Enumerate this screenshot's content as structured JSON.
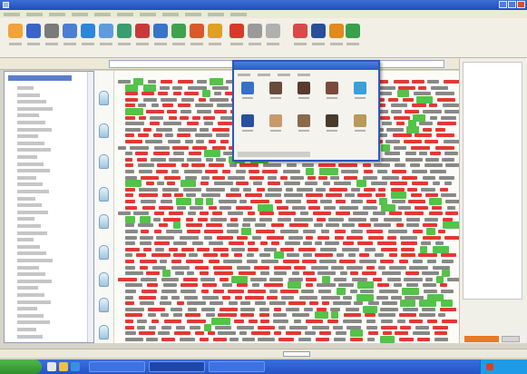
{
  "window": {
    "title": ""
  },
  "menu": {
    "items": [
      "",
      "",
      "",
      "",
      "",
      "",
      "",
      "",
      "",
      "",
      ""
    ]
  },
  "toolbar": {
    "buttons": [
      {
        "label": "",
        "icon": "new-document-icon",
        "color": "#f1a23a"
      },
      {
        "label": "",
        "icon": "save-icon",
        "color": "#3a64c8"
      },
      {
        "label": "",
        "icon": "print-icon",
        "color": "#7a7a7a"
      },
      {
        "label": "",
        "icon": "computer-icon",
        "color": "#4a7fd1"
      },
      {
        "label": "",
        "icon": "search-icon",
        "color": "#2f86d8"
      },
      {
        "label": "",
        "icon": "copy-icon",
        "color": "#5f9bdc"
      },
      {
        "label": "",
        "icon": "table-icon",
        "color": "#3a9d6e"
      },
      {
        "label": "",
        "icon": "font-icon",
        "color": "#c83a3a"
      },
      {
        "label": "",
        "icon": "globe-icon",
        "color": "#3a74c8"
      },
      {
        "label": "",
        "icon": "arrow-icon",
        "color": "#3fa34d"
      },
      {
        "label": "",
        "icon": "chart-icon",
        "color": "#d85a2a"
      },
      {
        "label": "",
        "icon": "palette-icon",
        "color": "#e0a020"
      },
      {
        "label": "",
        "icon": "shield-icon",
        "color": "#d83a2a"
      },
      {
        "label": "",
        "icon": "tools-icon",
        "color": "#9a9a9a"
      },
      {
        "label": "",
        "icon": "link-icon",
        "color": "#b0b0b0"
      },
      {
        "label": "",
        "icon": "figure-icon",
        "color": "#d84a4a"
      },
      {
        "label": "",
        "icon": "user-icon",
        "color": "#2a4f9a"
      },
      {
        "label": "",
        "icon": "help-icon",
        "color": "#e08a20"
      },
      {
        "label": "",
        "icon": "go-icon",
        "color": "#3aa04a"
      }
    ]
  },
  "address": {
    "value": ""
  },
  "tree": {
    "header": "",
    "items": [
      "",
      "",
      "",
      "",
      "",
      "",
      "",
      "",
      "",
      "",
      "",
      "",
      "",
      "",
      "",
      "",
      "",
      "",
      "",
      "",
      "",
      "",
      "",
      "",
      "",
      "",
      "",
      "",
      "",
      "",
      "",
      "",
      "",
      "",
      "",
      "",
      ""
    ]
  },
  "popup": {
    "title": "",
    "tabs": [
      "",
      "",
      "",
      ""
    ],
    "pictures": [
      {
        "caption": "",
        "icon": "bottle-icon",
        "color": "#3a6fc8"
      },
      {
        "caption": "",
        "icon": "face-icon",
        "color": "#6a4a3a"
      },
      {
        "caption": "",
        "icon": "face-icon",
        "color": "#5a3a2a"
      },
      {
        "caption": "",
        "icon": "person-icon",
        "color": "#7a4a3a"
      },
      {
        "caption": "",
        "icon": "bird-icon",
        "color": "#3aa0d8"
      },
      {
        "caption": "",
        "icon": "lamp-icon",
        "color": "#2a4fa0"
      },
      {
        "caption": "",
        "icon": "mug-icon",
        "color": "#c89a6a"
      },
      {
        "caption": "",
        "icon": "figure-icon",
        "color": "#8a6a4a"
      },
      {
        "caption": "",
        "icon": "person-icon",
        "color": "#4a3a2a"
      },
      {
        "caption": "",
        "icon": "book-icon",
        "color": "#b89a5a"
      }
    ],
    "status": ""
  },
  "statusbar": {
    "text": ""
  },
  "taskbar": {
    "start": "",
    "tasks": [
      "",
      "",
      ""
    ],
    "quick_colors": [
      "#e8e8e8",
      "#f0c040",
      "#3a8fe0"
    ],
    "tray_color": "#e23a2a"
  },
  "colors": {
    "accent": "#2f56b8",
    "marked_red": "#e03a33",
    "marked_green": "#55c24a"
  }
}
